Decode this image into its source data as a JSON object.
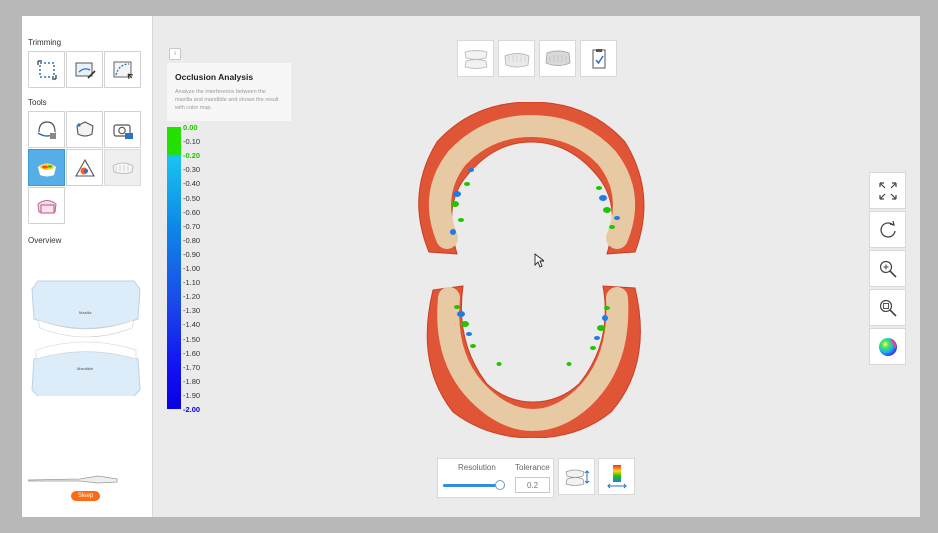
{
  "sidebar": {
    "trimming_title": "Trimming",
    "tools_title": "Tools",
    "overview_title": "Overview",
    "overview": {
      "maxilla_label": "Maxilla",
      "mandible_label": "Mandible"
    },
    "sleep_label": "Sleep"
  },
  "info": {
    "icon": "info-icon",
    "title": "Occlusion Analysis",
    "description": "Analyze the interference between the maxilla and mandible and shows the result with color map."
  },
  "scale": {
    "labels": [
      "0.00",
      "-0.10",
      "-0.20",
      "-0.30",
      "-0.40",
      "-0.50",
      "-0.60",
      "-0.70",
      "-0.80",
      "-0.90",
      "-1.00",
      "-1.10",
      "-1.20",
      "-1.30",
      "-1.40",
      "-1.50",
      "-1.60",
      "-1.70",
      "-1.80",
      "-1.90",
      "-2.00"
    ],
    "highlight_color": "#22c400",
    "end_color": "#0a00e6",
    "text_color": "#333333"
  },
  "controls": {
    "resolution_label": "Resolution",
    "tolerance_label": "Tolerance",
    "tolerance_value": "0.2",
    "resolution_level": 0.9
  },
  "colors": {
    "accent": "#56aee6",
    "sleep": "#ff6b12",
    "slider": "#2c8fe0"
  }
}
